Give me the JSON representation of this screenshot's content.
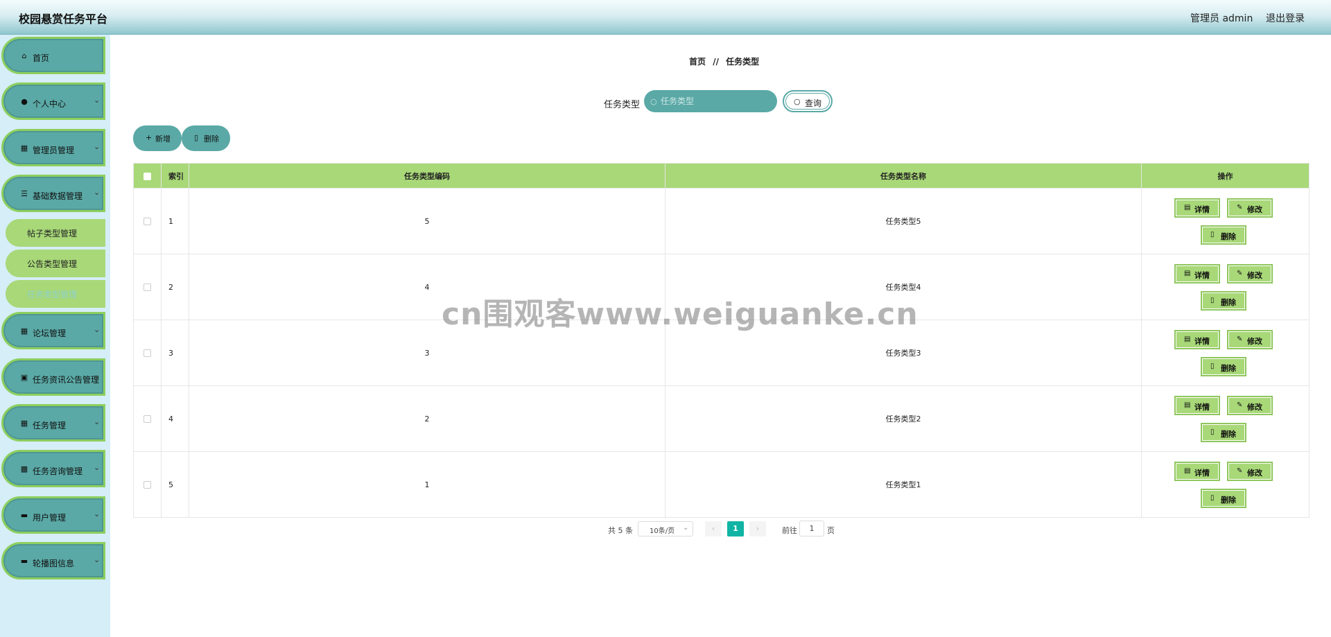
{
  "header": {
    "title": "校园悬赏任务平台",
    "user_label": "管理员 admin",
    "logout_label": "退出登录"
  },
  "sidebar": {
    "items": [
      {
        "label": "首页",
        "icon": "home-icon"
      },
      {
        "label": "个人中心",
        "icon": "user-icon"
      },
      {
        "label": "管理员管理",
        "icon": "grid-icon"
      },
      {
        "label": "基础数据管理",
        "icon": "list-icon"
      },
      {
        "label": "论坛管理",
        "icon": "grid-icon"
      },
      {
        "label": "任务资讯公告管理",
        "icon": "clipboard-icon"
      },
      {
        "label": "任务管理",
        "icon": "grid-icon"
      },
      {
        "label": "任务咨询管理",
        "icon": "apps-icon"
      },
      {
        "label": "用户管理",
        "icon": "monitor-icon"
      },
      {
        "label": "轮播图信息",
        "icon": "monitor-icon"
      }
    ],
    "sub_items": [
      {
        "label": "帖子类型管理"
      },
      {
        "label": "公告类型管理"
      },
      {
        "label": "任务类型管理",
        "active": true
      }
    ]
  },
  "breadcrumb": {
    "home": "首页",
    "separator": "//",
    "current": "任务类型"
  },
  "search": {
    "label": "任务类型",
    "placeholder": "任务类型",
    "button_label": "查询"
  },
  "actions": {
    "add_label": "新增",
    "delete_label": "删除"
  },
  "table": {
    "columns": [
      "索引",
      "任务类型编码",
      "任务类型名称",
      "操作"
    ],
    "rows": [
      {
        "index": "1",
        "code": "5",
        "name": "任务类型5"
      },
      {
        "index": "2",
        "code": "4",
        "name": "任务类型4"
      },
      {
        "index": "3",
        "code": "3",
        "name": "任务类型3"
      },
      {
        "index": "4",
        "code": "2",
        "name": "任务类型2"
      },
      {
        "index": "5",
        "code": "1",
        "name": "任务类型1"
      }
    ],
    "row_actions": {
      "detail_label": "详情",
      "edit_label": "修改",
      "delete_label": "删除"
    }
  },
  "pagination": {
    "total_label": "共 5 条",
    "page_size_label": "10条/页",
    "current_page": "1",
    "goto_label": "前往",
    "goto_value": "1",
    "page_unit": "页"
  },
  "watermark": "cn围观客www.weiguanke.cn",
  "colors": {
    "primary_teal": "#5aa9a6",
    "accent_green": "#a8d878",
    "active_page": "#11b4a4",
    "sidebar_bg": "#d6eef7"
  }
}
